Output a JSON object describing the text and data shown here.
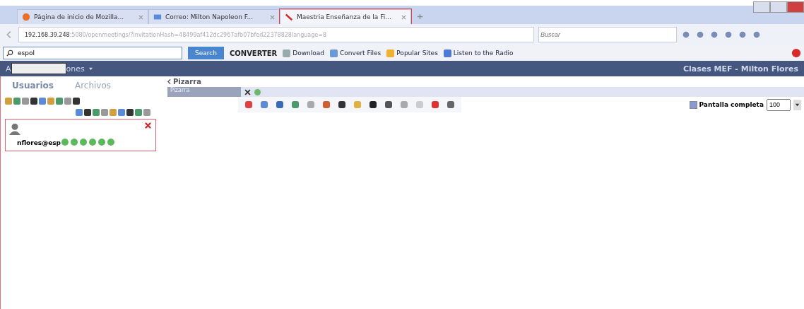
{
  "browser": {
    "tabs": [
      {
        "title": "Página de inicio de Mozilla...",
        "kind": "firefox",
        "selected": false
      },
      {
        "title": "Correo: Milton Napoleon F...",
        "kind": "mail",
        "selected": false
      },
      {
        "title": "Maestria Enseñanza de la Fi...",
        "kind": "app",
        "selected": true
      }
    ],
    "url": {
      "host": "192.168.39.248",
      "rest": ":5080/openmeetings/?invitationHash=48499af412dc2967afb07bfed22378828language=8"
    },
    "search": {
      "placeholder": "Buscar"
    },
    "toolbar": {
      "search_value": "espol",
      "search_button": "Search",
      "logo": "CONVERTER",
      "bookmarks": [
        {
          "label": "Download",
          "kind": "download"
        },
        {
          "label": "Convert Files",
          "kind": "convert"
        },
        {
          "label": "Popular Sites",
          "kind": "popular"
        },
        {
          "label": "Listen to the Radio",
          "kind": "radio"
        }
      ]
    }
  },
  "app": {
    "menu": {
      "first": "A",
      "rest": "ones"
    },
    "title": "Clases MEF - Milton Flores",
    "left_tabs": [
      {
        "label": "Usuarios",
        "selected": true
      },
      {
        "label": "Archivos",
        "selected": false
      }
    ],
    "user": {
      "name": "nflores@esp"
    },
    "whiteboard": {
      "back": "Pizarra",
      "tab": "Pizarra",
      "fullscreen": {
        "label": "Pantalla completa",
        "checked": true
      },
      "zoom": "100"
    }
  }
}
